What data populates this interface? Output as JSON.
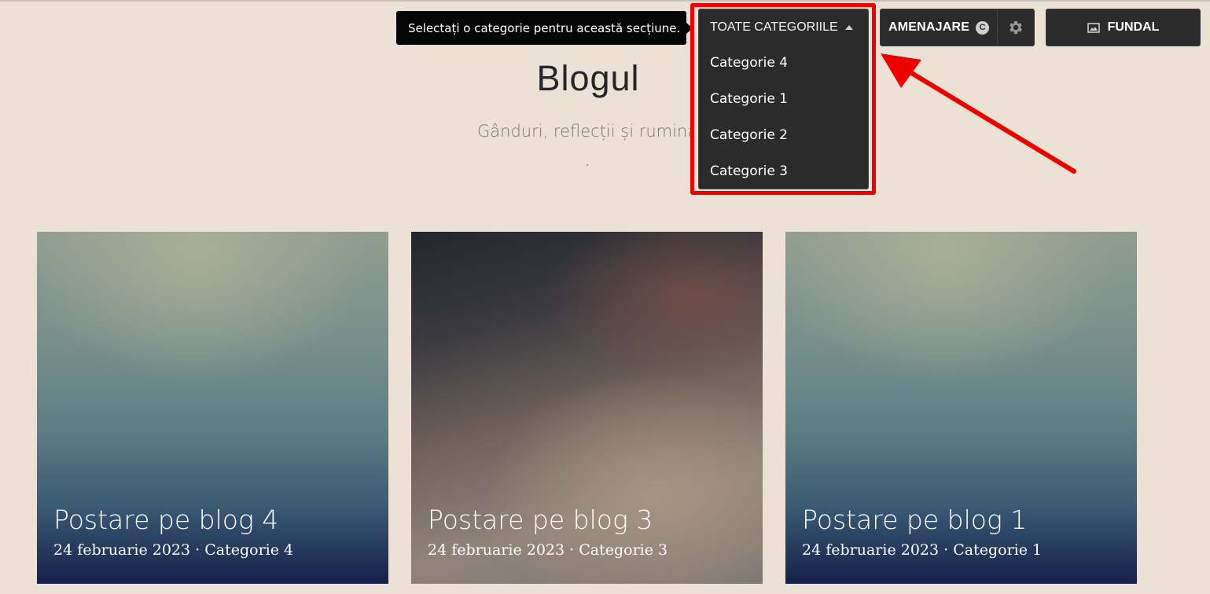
{
  "tooltip": {
    "text": "Selectați o categorie pentru această secțiune."
  },
  "category_dropdown": {
    "selected": "TOATE CATEGORIILE",
    "options": [
      "Categorie 4",
      "Categorie 1",
      "Categorie 2",
      "Categorie 3"
    ]
  },
  "toolbar": {
    "layout_label": "AMENAJARE",
    "layout_badge": "C",
    "settings_icon": "gear-icon",
    "background_label": "FUNDAL",
    "background_icon": "image-icon"
  },
  "page": {
    "title": "Blogul",
    "subtitle": "Gânduri, reflecții și ruminați",
    "dot": "."
  },
  "posts": [
    {
      "title": "Postare pe blog 4",
      "date": "24 februarie 2023",
      "category": "Categorie 4",
      "meta": "24 februarie 2023 · Categorie 4"
    },
    {
      "title": "Postare pe blog 3",
      "date": "24 februarie 2023",
      "category": "Categorie 3",
      "meta": "24 februarie 2023 · Categorie 3"
    },
    {
      "title": "Postare pe blog 1",
      "date": "24 februarie 2023",
      "category": "Categorie 1",
      "meta": "24 februarie 2023 · Categorie 1"
    }
  ],
  "colors": {
    "page_background": "#ebe1d5",
    "toolbar_dark": "#2b2b2b",
    "highlight_red": "#ee0000"
  }
}
